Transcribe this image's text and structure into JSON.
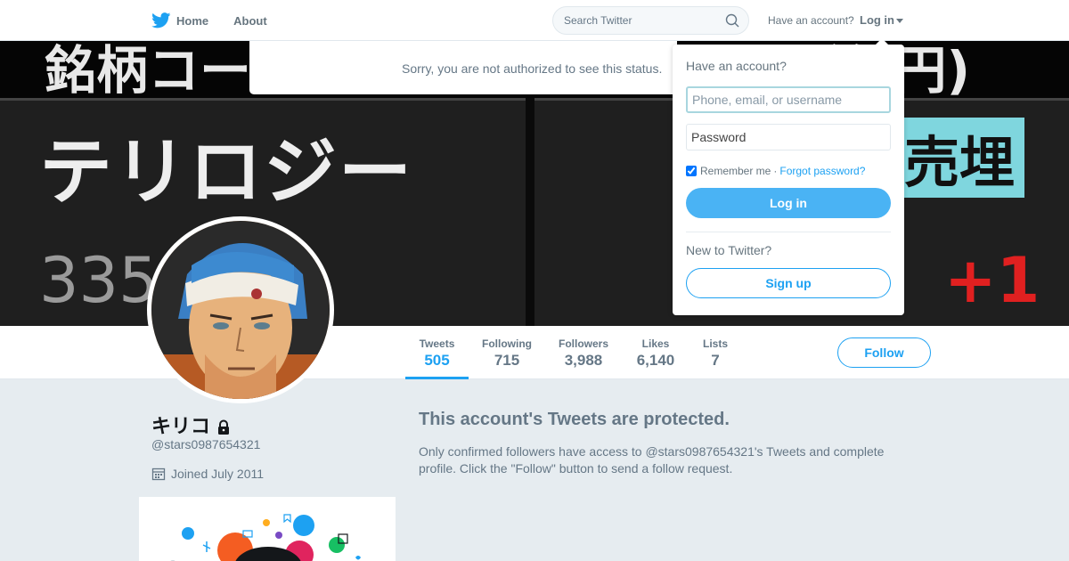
{
  "nav": {
    "home_label": "Home",
    "about_label": "About",
    "search_placeholder": "Search Twitter",
    "have_account": "Have an account?",
    "login_label": "Log in"
  },
  "banner": {
    "top_left_text": "銘柄コー",
    "top_right_text": "益(円)",
    "main_text": "テリロジー",
    "number_text": "335",
    "sell_text": "売埋",
    "plus_text": "+1"
  },
  "error": {
    "message": "Sorry, you are not authorized to see this status."
  },
  "stats": [
    {
      "label": "Tweets",
      "value": "505"
    },
    {
      "label": "Following",
      "value": "715"
    },
    {
      "label": "Followers",
      "value": "3,988"
    },
    {
      "label": "Likes",
      "value": "6,140"
    },
    {
      "label": "Lists",
      "value": "7"
    }
  ],
  "follow_label": "Follow",
  "profile": {
    "name": "キリコ",
    "handle": "@stars0987654321",
    "joined": "Joined July 2011"
  },
  "protected": {
    "title": "This account's Tweets are protected.",
    "text": "Only confirmed followers have access to @stars0987654321's Tweets and complete profile. Click the \"Follow\" button to send a follow request."
  },
  "login_dropdown": {
    "title": "Have an account?",
    "username_placeholder": "Phone, email, or username",
    "password_placeholder": "Password",
    "remember_label": "Remember me",
    "separator": "·",
    "forgot_label": "Forgot password?",
    "login_button": "Log in",
    "new_to": "New to Twitter?",
    "signup_button": "Sign up"
  },
  "colors": {
    "accent": "#1da1f2",
    "login_button": "#4ab3f4",
    "background": "#e6ecf0",
    "muted_text": "#657786"
  },
  "icons": [
    "twitter-bird-icon",
    "search-icon",
    "caret-down-icon",
    "lock-icon",
    "calendar-icon"
  ]
}
